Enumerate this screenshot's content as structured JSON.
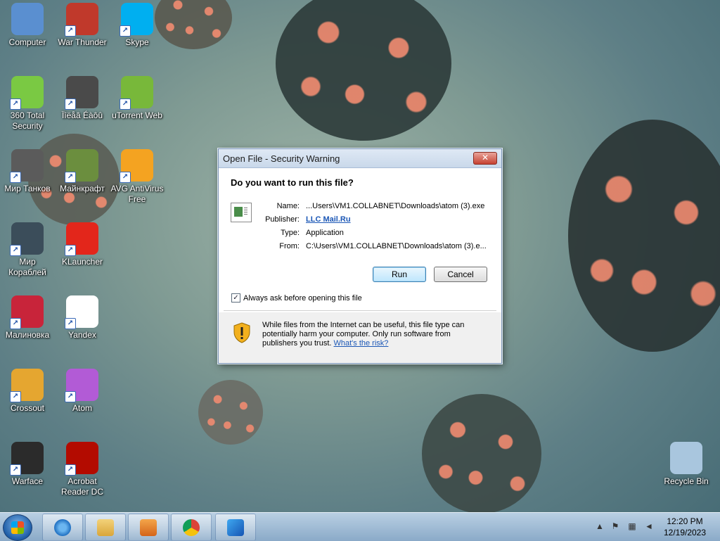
{
  "desktop": {
    "icons": [
      {
        "label": "Computer",
        "color": "#5a8fd0"
      },
      {
        "label": "War Thunder",
        "color": "#c0392b"
      },
      {
        "label": "Skype",
        "color": "#00aff0"
      },
      {
        "label": "360 Total Security",
        "color": "#7ac943"
      },
      {
        "label": "Ïîëåâ Éàôû",
        "color": "#4a4a4a"
      },
      {
        "label": "uTorrent Web",
        "color": "#78b83a"
      },
      {
        "label": "Мир Танков",
        "color": "#5b5b5b"
      },
      {
        "label": "Майнкрафт",
        "color": "#6b8e3e"
      },
      {
        "label": "AVG AntiVirus Free",
        "color": "#f4a321"
      },
      {
        "label": "Мир Кораблей",
        "color": "#3b4d5a"
      },
      {
        "label": "KLauncher",
        "color": "#e3261b"
      },
      {
        "label": "Малиновка",
        "color": "#c8243a"
      },
      {
        "label": "Yandex",
        "color": "#ffffff"
      },
      {
        "label": "Crossout",
        "color": "#e5a630"
      },
      {
        "label": "Atom",
        "color": "#b25bd6"
      },
      {
        "label": "Warface",
        "color": "#2b2b2b"
      },
      {
        "label": "Acrobat Reader DC",
        "color": "#b30b00"
      },
      {
        "label": "Recycle Bin",
        "color": "#a9c6de"
      }
    ]
  },
  "dialog": {
    "title": "Open File - Security Warning",
    "close_label": "✕",
    "question": "Do you want to run this file?",
    "name_label": "Name:",
    "name_value": "...Users\\VM1.COLLABNET\\Downloads\\atom (3).exe",
    "publisher_label": "Publisher:",
    "publisher_value": "LLC Mail.Ru",
    "type_label": "Type:",
    "type_value": "Application",
    "from_label": "From:",
    "from_value": "C:\\Users\\VM1.COLLABNET\\Downloads\\atom (3).e...",
    "run_label": "Run",
    "cancel_label": "Cancel",
    "checkbox_label": "Always ask before opening this file",
    "checkbox_checked": true,
    "warning_text": "While files from the Internet can be useful, this file type can potentially harm your computer. Only run software from publishers you trust.",
    "risk_link": "What's the risk?"
  },
  "taskbar": {
    "apps": [
      "internet-explorer",
      "file-explorer",
      "media-player",
      "chrome",
      "app-installer"
    ],
    "time": "12:20 PM",
    "date": "12/19/2023"
  }
}
